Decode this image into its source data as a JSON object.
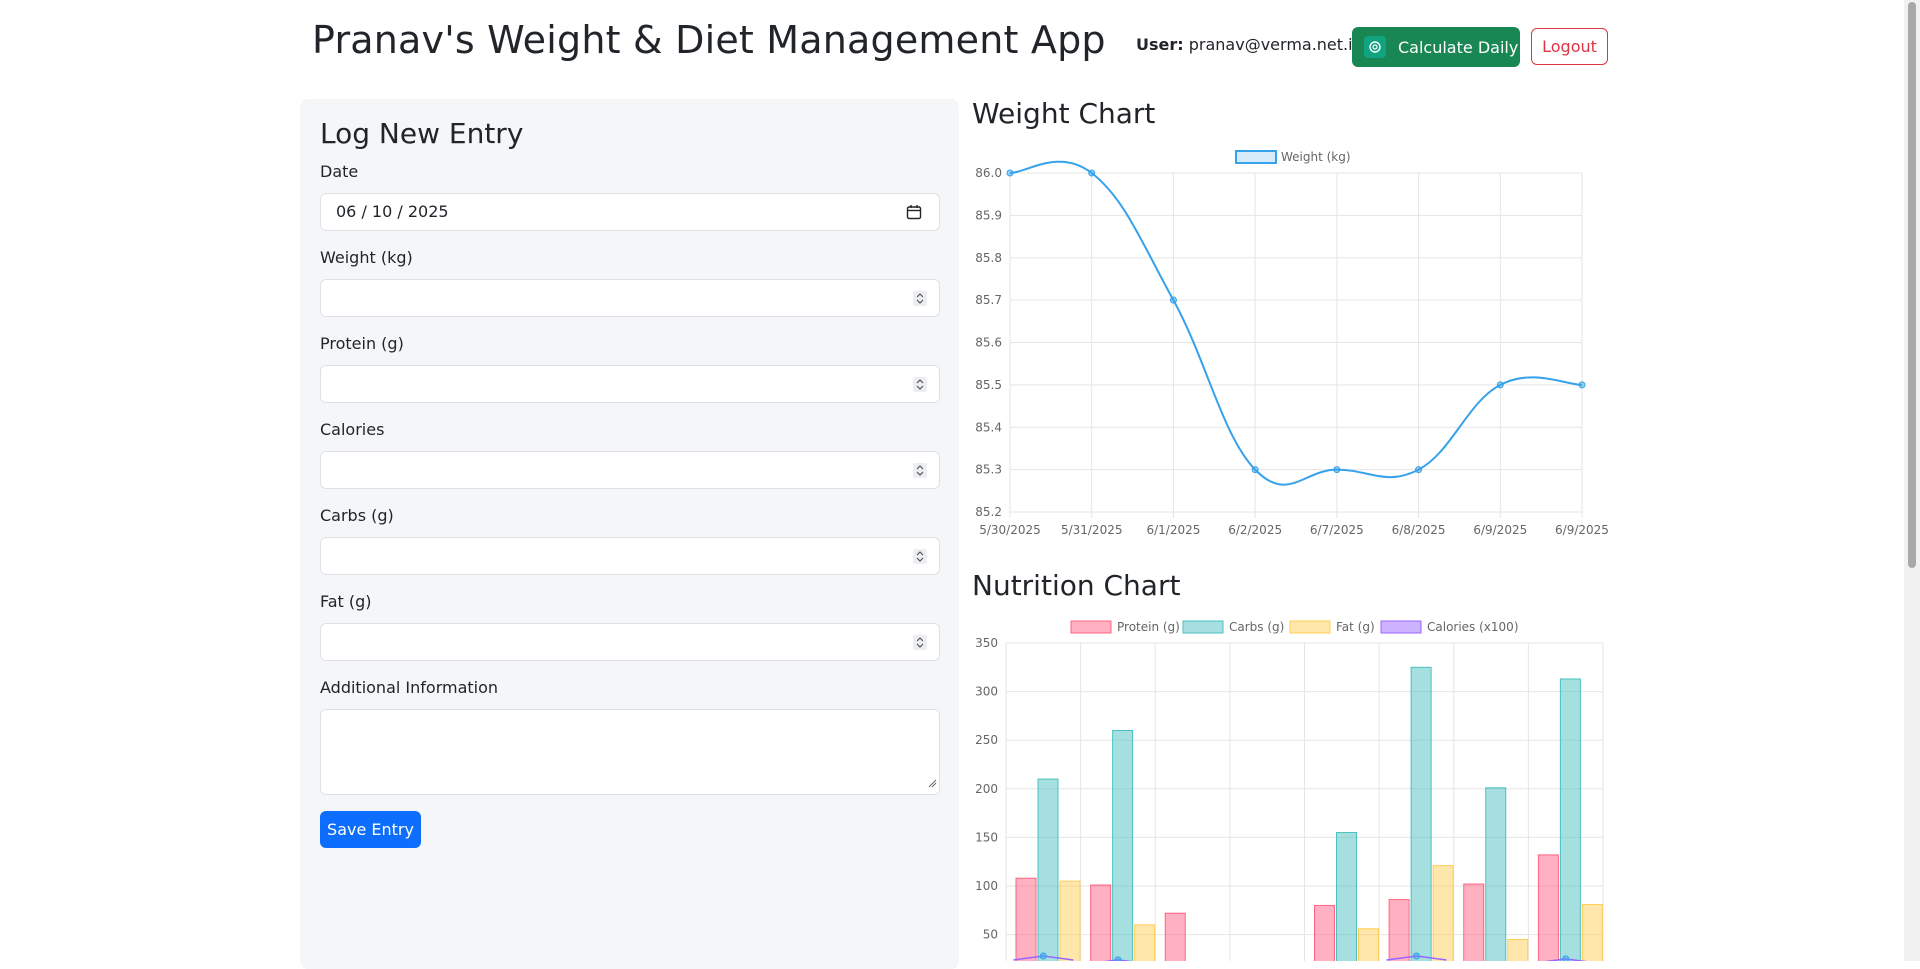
{
  "header": {
    "title": "Pranav's Weight & Diet Management App",
    "user_label": "User:",
    "user_email": "pranav@verma.net.in",
    "calc_button": "Calculate Daily",
    "logout_button": "Logout"
  },
  "form": {
    "heading": "Log New Entry",
    "date_label": "Date",
    "date_value": "06 / 10 / 2025",
    "weight_label": "Weight (kg)",
    "protein_label": "Protein (g)",
    "calories_label": "Calories",
    "carbs_label": "Carbs (g)",
    "fat_label": "Fat (g)",
    "info_label": "Additional Information",
    "save_button": "Save Entry"
  },
  "colors": {
    "primary": "#0d6efd",
    "success": "#198754",
    "danger": "#dc3545"
  },
  "icons": {
    "calc": "openai-icon",
    "date": "calendar-icon"
  },
  "weight_chart": {
    "heading": "Weight Chart",
    "chart_data": {
      "type": "line",
      "categories": [
        "5/30/2025",
        "5/31/2025",
        "6/1/2025",
        "6/2/2025",
        "6/7/2025",
        "6/8/2025",
        "6/9/2025",
        "6/9/2025"
      ],
      "series": [
        {
          "name": "Weight (kg)",
          "values": [
            86.0,
            86.0,
            85.7,
            85.3,
            85.3,
            85.3,
            85.5,
            85.5
          ],
          "color": "#36a2eb"
        }
      ],
      "ylim": [
        85.2,
        86.0
      ],
      "yticks": [
        "86.0",
        "85.9",
        "85.8",
        "85.7",
        "85.6",
        "85.5",
        "85.4",
        "85.3",
        "85.2"
      ],
      "legend": "top-center",
      "grid": true
    }
  },
  "nutrition_chart": {
    "heading": "Nutrition Chart",
    "chart_data": {
      "type": "bar",
      "series": [
        {
          "name": "Protein (g)",
          "values": [
            108,
            101,
            72,
            null,
            80,
            86,
            102,
            132
          ],
          "color": "#ff6384"
        },
        {
          "name": "Carbs (g)",
          "values": [
            210,
            260,
            null,
            null,
            155,
            325,
            201,
            313
          ],
          "color": "#4bc0c0"
        },
        {
          "name": "Fat (g)",
          "values": [
            105,
            60,
            null,
            null,
            56,
            121,
            45,
            81
          ],
          "color": "#ffcd56"
        },
        {
          "name": "Calories (x100)",
          "values": [
            28,
            24,
            null,
            null,
            null,
            28,
            null,
            25
          ],
          "color": "#9966ff"
        }
      ],
      "ylim": [
        0,
        350
      ],
      "yticks": [
        "350",
        "300",
        "250",
        "200",
        "150",
        "100",
        "50"
      ],
      "legend": "top-center",
      "grid": true
    }
  }
}
